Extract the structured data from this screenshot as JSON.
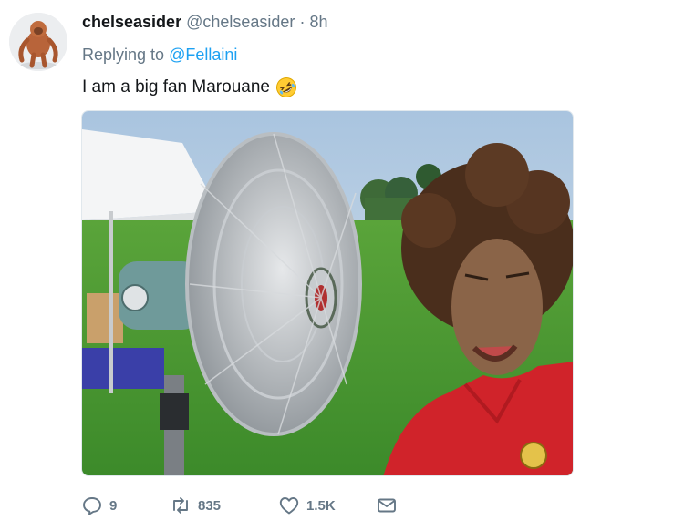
{
  "tweet": {
    "display_name": "chelseasider",
    "handle": "@chelseasider",
    "separator": "·",
    "time": "8h",
    "replying_prefix": "Replying to",
    "replying_to": "@Fellaini",
    "text": "I am a big fan Marouane",
    "emoji": "rolling-on-floor-laughing-emoji"
  },
  "actions": {
    "replies": "9",
    "retweets": "835",
    "likes": "1.5K"
  },
  "icons": {
    "reply": "reply-icon",
    "retweet": "retweet-icon",
    "like": "heart-icon",
    "dm": "envelope-icon"
  },
  "colors": {
    "link": "#1da1f2",
    "secondary_text": "#657786",
    "primary_text": "#14171a"
  }
}
